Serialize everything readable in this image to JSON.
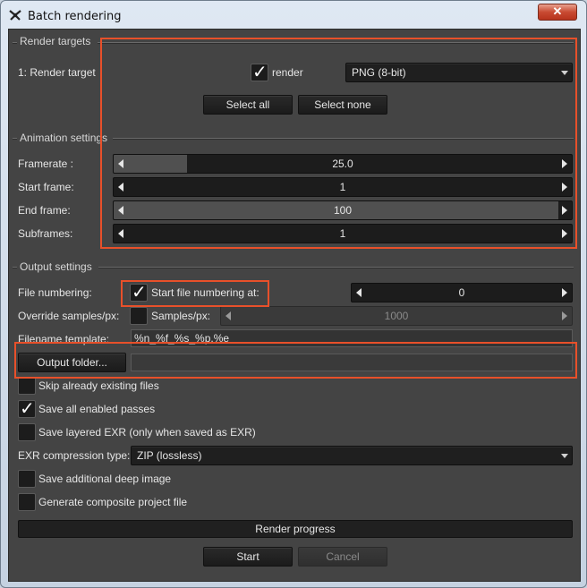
{
  "window": {
    "title": "Batch rendering",
    "close_glyph": "✕",
    "app_icon": "octane-logo-icon"
  },
  "render_targets": {
    "section_label": "Render targets",
    "row_label": "1: Render target",
    "render_checked": true,
    "render_label": "render",
    "format_value": "PNG (8-bit)",
    "select_all": "Select all",
    "select_none": "Select none"
  },
  "animation": {
    "section_label": "Animation settings",
    "rows": [
      {
        "label": "Framerate :",
        "value": "25.0",
        "fill": 0.16
      },
      {
        "label": "Start frame:",
        "value": "1",
        "fill": 0
      },
      {
        "label": "End frame:",
        "value": "100",
        "fill": 0.97
      },
      {
        "label": "Subframes:",
        "value": "1",
        "fill": 0
      }
    ]
  },
  "output": {
    "section_label": "Output settings",
    "file_numbering_label": "File numbering:",
    "start_numbering_checked": true,
    "start_numbering_label": "Start file numbering at:",
    "start_numbering_value": "0",
    "override_label": "Override samples/px:",
    "override_checked": false,
    "samples_label": "Samples/px:",
    "samples_value": "1000",
    "template_label": "Filename template:",
    "template_value": "%n_%f_%s_%p.%e",
    "output_folder_button": "Output folder...",
    "output_folder_value": "",
    "options": [
      {
        "label": "Skip already existing files",
        "checked": false
      },
      {
        "label": "Save all enabled passes",
        "checked": true
      },
      {
        "label": "Save layered EXR (only when saved as EXR)",
        "checked": false
      }
    ],
    "exr_label": "EXR compression type:",
    "exr_value": "ZIP (lossless)",
    "options2": [
      {
        "label": "Save additional deep image",
        "checked": false
      },
      {
        "label": "Generate composite project file",
        "checked": false
      }
    ]
  },
  "footer": {
    "progress_label": "Render progress",
    "start": "Start",
    "cancel": "Cancel"
  },
  "colors": {
    "panel": "#444444",
    "highlight": "#e8502a"
  }
}
